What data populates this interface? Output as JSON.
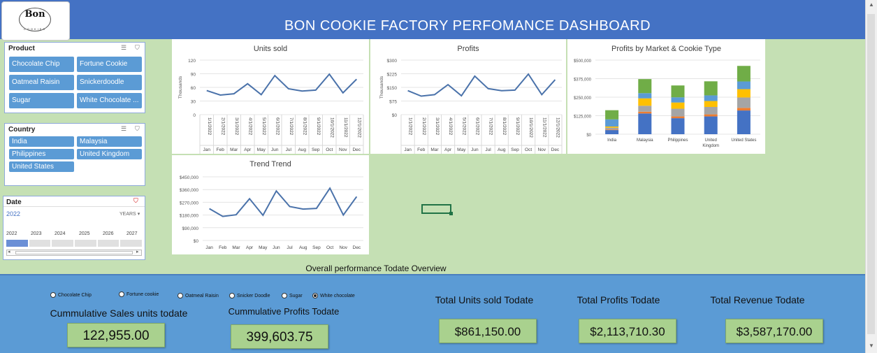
{
  "title": "BON COOKIE FACTORY  PERFOMANCE  DASHBOARD",
  "logo": {
    "name": "Bon",
    "sub": "COOKIES"
  },
  "product_slicer": {
    "title": "Product",
    "items": [
      "Chocolate Chip",
      "Fortune Cookie",
      "Oatmeal Raisin",
      "Snickerdoodle",
      "Sugar",
      "White Chocolate ..."
    ]
  },
  "country_slicer": {
    "title": "Country",
    "items": [
      "India",
      "Malaysia",
      "Philippines",
      "United Kingdom",
      "United States"
    ]
  },
  "date_slicer": {
    "title": "Date",
    "selected": "2022",
    "level": "YEARS",
    "years": [
      "2022",
      "2023",
      "2024",
      "2025",
      "2026",
      "2027"
    ]
  },
  "chart_data": [
    {
      "type": "line",
      "title": "Units sold",
      "ylabel": "Thousands",
      "yticks": [
        "120",
        "90",
        "60",
        "30",
        "0"
      ],
      "ylim": [
        0,
        120
      ],
      "categories": [
        "1/1/2022",
        "2/1/2022",
        "3/1/2022",
        "4/1/2022",
        "5/1/2022",
        "6/1/2022",
        "7/1/2022",
        "8/1/2022",
        "9/1/2022",
        "10/1/2022",
        "11/1/2022",
        "12/1/2022"
      ],
      "months": [
        "Jan",
        "Feb",
        "Mar",
        "Apr",
        "May",
        "Jun",
        "Jul",
        "Aug",
        "Sep",
        "Oct",
        "Nov",
        "Dec"
      ],
      "values": [
        53,
        43,
        46,
        68,
        44,
        86,
        57,
        52,
        54,
        89,
        48,
        78
      ],
      "color": "#4a72aa"
    },
    {
      "type": "line",
      "title": "Profits",
      "ylabel": "Thousands",
      "yticks": [
        "$300",
        "$225",
        "$150",
        "$75",
        "$0"
      ],
      "ylim": [
        0,
        300
      ],
      "categories": [
        "1/1/2022",
        "2/1/2022",
        "3/1/2022",
        "4/1/2022",
        "5/1/2022",
        "6/1/2022",
        "7/1/2022",
        "8/1/2022",
        "9/1/2022",
        "10/1/2022",
        "11/1/2022",
        "12/1/2022"
      ],
      "months": [
        "Jan",
        "Feb",
        "Mar",
        "Apr",
        "May",
        "Jun",
        "Jul",
        "Aug",
        "Sep",
        "Oct",
        "Nov",
        "Dec"
      ],
      "values": [
        132,
        102,
        110,
        165,
        104,
        212,
        143,
        132,
        135,
        223,
        110,
        192
      ],
      "color": "#4a72aa"
    },
    {
      "type": "bar",
      "stacked": true,
      "title": "Profits by Market & Cookie Type",
      "yticks": [
        "$500,000",
        "$375,000",
        "$250,000",
        "$125,000",
        "$0"
      ],
      "ylim": [
        0,
        500000
      ],
      "categories": [
        "India",
        "Malaysia",
        "Philippines",
        "United Kingdom",
        "United States"
      ],
      "series": [
        {
          "values": [
            28000,
            140000,
            108000,
            120000,
            160000
          ],
          "color": "#4472c4"
        },
        {
          "values": [
            4000,
            12000,
            12000,
            14000,
            18000
          ],
          "color": "#ed7d31"
        },
        {
          "values": [
            12000,
            40000,
            52000,
            50000,
            70000
          ],
          "color": "#a5a5a5"
        },
        {
          "values": [
            8000,
            50000,
            42000,
            40000,
            56000
          ],
          "color": "#ffc000"
        },
        {
          "values": [
            48000,
            35000,
            35000,
            38000,
            52000
          ],
          "color": "#5b9bd5"
        },
        {
          "values": [
            62000,
            95000,
            80000,
            95000,
            105000
          ],
          "color": "#70ad47"
        }
      ]
    },
    {
      "type": "line",
      "title": "Trend Trend",
      "yticks": [
        "$450,000",
        "$360,000",
        "$270,000",
        "$180,000",
        "$90,000",
        "$0"
      ],
      "ylim": [
        0,
        450000
      ],
      "categories": [
        "Jan",
        "Feb",
        "Mar",
        "Apr",
        "May",
        "Jun",
        "Jul",
        "Aug",
        "Sep",
        "Oct",
        "Nov",
        "Dec"
      ],
      "values": [
        225000,
        170000,
        182000,
        295000,
        178000,
        350000,
        240000,
        222000,
        227000,
        370000,
        180000,
        310000
      ],
      "color": "#4a72aa"
    }
  ],
  "overview_label": "Overall performance Todate Overview",
  "radios": [
    {
      "label": "Chocolate Chip",
      "checked": false
    },
    {
      "label": "Fortune cookie",
      "checked": false
    },
    {
      "label": "Oatmeal Raisin",
      "checked": false
    },
    {
      "label": "Snicker Doodle",
      "checked": false
    },
    {
      "label": "Sugar",
      "checked": false
    },
    {
      "label": "White chocolate",
      "checked": true
    }
  ],
  "kpis": {
    "cum_sales_label": "Cummulative Sales units todate",
    "cum_sales_value": "122,955.00",
    "cum_profits_label": "Cummulative Profits Todate",
    "cum_profits_value": "399,603.75",
    "units_label": "Total Units sold Todate",
    "units_value": "$861,150.00",
    "profits_label": "Total Profits Todate",
    "profits_value": "$2,113,710.30",
    "revenue_label": "Total Revenue Todate",
    "revenue_value": "$3,587,170.00"
  }
}
